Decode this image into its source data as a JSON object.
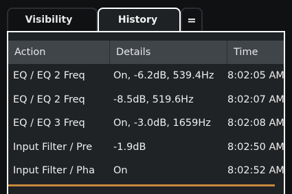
{
  "tabs": [
    {
      "label": "Visibility",
      "active": false
    },
    {
      "label": "History",
      "active": true
    },
    {
      "label": "=",
      "active": false
    }
  ],
  "table": {
    "columns": [
      "Action",
      "Details",
      "Time"
    ],
    "rows": [
      {
        "action": "EQ / EQ 2 Freq",
        "details": "On, -6.2dB, 539.4Hz",
        "time": "8:02:05 AM"
      },
      {
        "action": "EQ / EQ 2 Freq",
        "details": "-8.5dB, 519.6Hz",
        "time": "8:02:07 AM"
      },
      {
        "action": "EQ / EQ 3 Freq",
        "details": "On, -3.0dB, 1659Hz",
        "time": "8:02:08 AM"
      },
      {
        "action": "Input Filter / Pre",
        "details": "-1.9dB",
        "time": "8:02:50 AM"
      },
      {
        "action": "Input Filter / Pha",
        "details": "On",
        "time": "8:02:52 AM"
      }
    ]
  },
  "colors": {
    "accent": "#c9893a",
    "header_bg": "#40454a",
    "panel_bg": "#202326"
  }
}
